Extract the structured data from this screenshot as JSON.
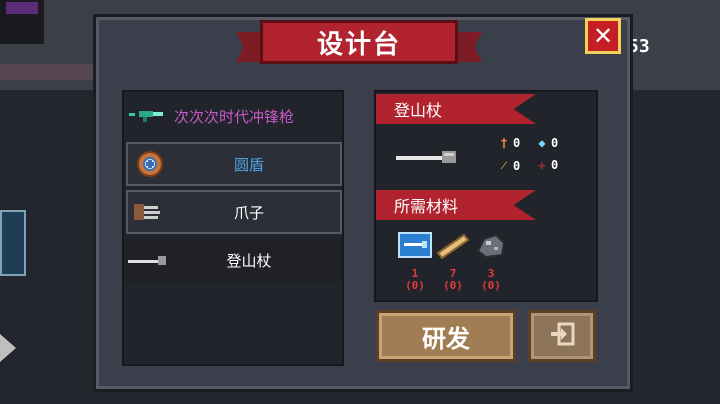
{
  "title": "设计台",
  "close_label": "✕",
  "background": {
    "counter_text": "53"
  },
  "recipes": [
    {
      "name": "次次次时代冲锋枪",
      "icon": "smg-icon",
      "color": "#c85ac8"
    },
    {
      "name": "圆盾",
      "icon": "round-shield-icon",
      "color": "#4ca3e6"
    },
    {
      "name": "爪子",
      "icon": "claw-icon",
      "color": "#ffffff"
    },
    {
      "name": "登山杖",
      "icon": "trekking-pole-icon",
      "color": "#ffffff"
    }
  ],
  "detail": {
    "weapon_name": "登山杖",
    "stats": [
      {
        "icon": "attack-icon",
        "value": "0"
      },
      {
        "icon": "energy-icon",
        "value": "0"
      },
      {
        "icon": "crit-icon",
        "value": "0"
      },
      {
        "icon": "accuracy-icon",
        "value": "0"
      }
    ],
    "materials_label": "所需材料",
    "materials": [
      {
        "icon": "blueprint-icon",
        "required": "1",
        "owned": "(0)"
      },
      {
        "icon": "wood-icon",
        "required": "7",
        "owned": "(0)"
      },
      {
        "icon": "ore-icon",
        "required": "3",
        "owned": "(0)"
      }
    ]
  },
  "buttons": {
    "research": "研发",
    "exit_icon": "exit-icon"
  },
  "colors": {
    "banner": "#b0232f",
    "panel": "#3b3f4b",
    "button": "#a07d52",
    "shortage": "#e23b3b"
  }
}
